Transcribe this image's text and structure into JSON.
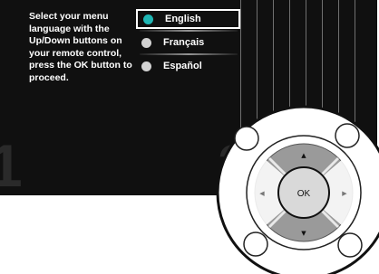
{
  "prompt": "Select your menu language with the Up/Down buttons on your remote control, press the OK button to proceed.",
  "languages": [
    {
      "label": "English",
      "selected": true,
      "dot_color": "#1fb6b4"
    },
    {
      "label": "Français",
      "selected": false,
      "dot_color": "#d2d2d2"
    },
    {
      "label": "Español",
      "selected": false,
      "dot_color": "#d2d2d2"
    }
  ],
  "steps": {
    "left": "1",
    "right": "2"
  },
  "remote": {
    "ok_label": "OK",
    "up_glyph": "▲",
    "down_glyph": "▼",
    "left_glyph": "◀",
    "right_glyph": "▶"
  }
}
